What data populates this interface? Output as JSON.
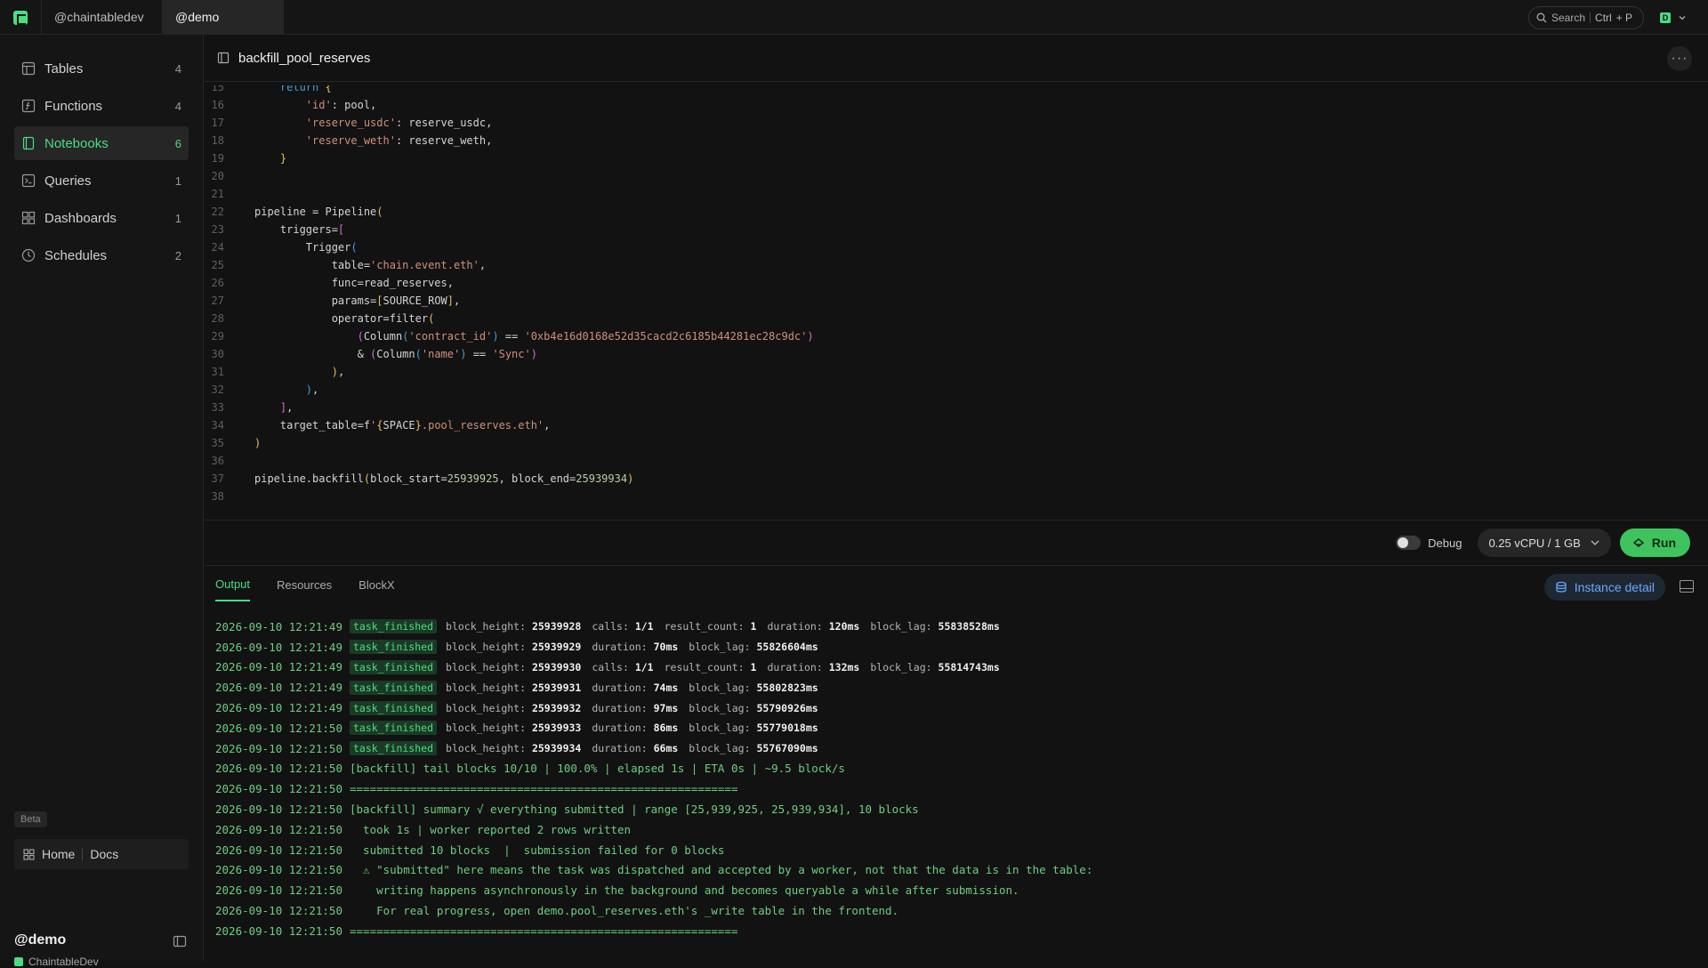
{
  "topbar": {
    "tabs": [
      {
        "label": "@chaintabledev"
      },
      {
        "label": "@demo"
      }
    ],
    "search": {
      "label": "Search",
      "shortcut_mod": "Ctrl",
      "shortcut_key": "+ P"
    },
    "account": {
      "badge": "D"
    }
  },
  "sidebar": {
    "items": [
      {
        "label": "Tables",
        "count": "4",
        "icon": "table-icon"
      },
      {
        "label": "Functions",
        "count": "4",
        "icon": "function-icon"
      },
      {
        "label": "Notebooks",
        "count": "6",
        "icon": "notebook-icon",
        "active": true
      },
      {
        "label": "Queries",
        "count": "1",
        "icon": "terminal-icon"
      },
      {
        "label": "Dashboards",
        "count": "1",
        "icon": "dashboard-icon"
      },
      {
        "label": "Schedules",
        "count": "2",
        "icon": "clock-icon"
      }
    ],
    "beta_label": "Beta",
    "home_label": "Home",
    "docs_label": "Docs",
    "space_name": "@demo",
    "space_org": "ChaintableDev"
  },
  "notebook": {
    "title": "backfill_pool_reserves",
    "code_first_line": "15",
    "code_last_line": "38"
  },
  "run_bar": {
    "debug_label": "Debug",
    "resource": "0.25 vCPU / 1 GB",
    "run_label": "Run"
  },
  "output": {
    "tabs": [
      "Output",
      "Resources",
      "BlockX"
    ],
    "active_tab": "Output",
    "instance_detail_label": "Instance detail",
    "badge_text": "task_finished",
    "rows": [
      {
        "ts": "2026-09-10 12:21:49",
        "kv": [
          [
            "block_height:",
            "25939928"
          ],
          [
            "calls:",
            "1/1"
          ],
          [
            "result_count:",
            "1"
          ],
          [
            "duration:",
            "120ms"
          ],
          [
            "block_lag:",
            "55838528ms"
          ]
        ]
      },
      {
        "ts": "2026-09-10 12:21:49",
        "kv": [
          [
            "block_height:",
            "25939929"
          ],
          [
            "duration:",
            "70ms"
          ],
          [
            "block_lag:",
            "55826604ms"
          ]
        ]
      },
      {
        "ts": "2026-09-10 12:21:49",
        "kv": [
          [
            "block_height:",
            "25939930"
          ],
          [
            "calls:",
            "1/1"
          ],
          [
            "result_count:",
            "1"
          ],
          [
            "duration:",
            "132ms"
          ],
          [
            "block_lag:",
            "55814743ms"
          ]
        ]
      },
      {
        "ts": "2026-09-10 12:21:49",
        "kv": [
          [
            "block_height:",
            "25939931"
          ],
          [
            "duration:",
            "74ms"
          ],
          [
            "block_lag:",
            "55802823ms"
          ]
        ]
      },
      {
        "ts": "2026-09-10 12:21:49",
        "kv": [
          [
            "block_height:",
            "25939932"
          ],
          [
            "duration:",
            "97ms"
          ],
          [
            "block_lag:",
            "55790926ms"
          ]
        ]
      },
      {
        "ts": "2026-09-10 12:21:50",
        "kv": [
          [
            "block_height:",
            "25939933"
          ],
          [
            "duration:",
            "86ms"
          ],
          [
            "block_lag:",
            "55779018ms"
          ]
        ]
      },
      {
        "ts": "2026-09-10 12:21:50",
        "kv": [
          [
            "block_height:",
            "25939934"
          ],
          [
            "duration:",
            "66ms"
          ],
          [
            "block_lag:",
            "55767090ms"
          ]
        ]
      },
      {
        "ts": "2026-09-10 12:21:50",
        "msg": "[backfill] tail blocks 10/10 | 100.0% | elapsed 1s | ETA 0s | ~9.5 block/s"
      },
      {
        "ts": "2026-09-10 12:21:50",
        "msg": "=========================================================="
      },
      {
        "ts": "2026-09-10 12:21:50",
        "msg": "[backfill] summary √ everything submitted | range [25,939,925, 25,939,934], 10 blocks"
      },
      {
        "ts": "2026-09-10 12:21:50",
        "msg": "  took 1s | worker reported 2 rows written"
      },
      {
        "ts": "2026-09-10 12:21:50",
        "msg": "  submitted 10 blocks  |  submission failed for 0 blocks"
      },
      {
        "ts": "2026-09-10 12:21:50",
        "msg": "  ⚠ \"submitted\" here means the task was dispatched and accepted by a worker, not that the data is in the table:"
      },
      {
        "ts": "2026-09-10 12:21:50",
        "msg": "    writing happens asynchronously in the background and becomes queryable a while after submission."
      },
      {
        "ts": "2026-09-10 12:21:50",
        "msg": "    For real progress, open demo.pool_reserves.eth's _write table in the frontend."
      },
      {
        "ts": "2026-09-10 12:21:50",
        "msg": "=========================================================="
      }
    ]
  },
  "code_lines": [
    {
      "n": "15",
      "html": "    <span class=\"b3\">return</span> <span class=\"b1\">{</span>"
    },
    {
      "n": "16",
      "html": "        <span class=\"s\">'id'</span>: pool,"
    },
    {
      "n": "17",
      "html": "        <span class=\"s\">'reserve_usdc'</span>: reserve_usdc,"
    },
    {
      "n": "18",
      "html": "        <span class=\"s\">'reserve_weth'</span>: reserve_weth,"
    },
    {
      "n": "19",
      "html": "    <span class=\"b1\">}</span>"
    },
    {
      "n": "20",
      "html": ""
    },
    {
      "n": "21",
      "html": ""
    },
    {
      "n": "22",
      "html": "pipeline = Pipeline<span class=\"b1\">(</span>"
    },
    {
      "n": "23",
      "html": "    triggers=<span class=\"b2\">[</span>"
    },
    {
      "n": "24",
      "html": "        Trigger<span class=\"b3\">(</span>"
    },
    {
      "n": "25",
      "html": "            table=<span class=\"s\">'chain.event.eth'</span>,"
    },
    {
      "n": "26",
      "html": "            func=read_reserves,"
    },
    {
      "n": "27",
      "html": "            params=<span class=\"b1\">[</span>SOURCE_ROW<span class=\"b1\">]</span>,"
    },
    {
      "n": "28",
      "html": "            operator=filter<span class=\"b1\">(</span>"
    },
    {
      "n": "29",
      "html": "                <span class=\"b2\">(</span>Column<span class=\"b3\">(</span><span class=\"s\">'contract_id'</span><span class=\"b3\">)</span> == <span class=\"s\">'0xb4e16d0168e52d35cacd2c6185b44281ec28c9dc'</span><span class=\"b2\">)</span>"
    },
    {
      "n": "30",
      "html": "                &amp; <span class=\"b2\">(</span>Column<span class=\"b3\">(</span><span class=\"s\">'name'</span><span class=\"b3\">)</span> == <span class=\"s\">'Sync'</span><span class=\"b2\">)</span>"
    },
    {
      "n": "31",
      "html": "            <span class=\"b1\">)</span>,"
    },
    {
      "n": "32",
      "html": "        <span class=\"b3\">)</span>,"
    },
    {
      "n": "33",
      "html": "    <span class=\"b2\">]</span>,"
    },
    {
      "n": "34",
      "html": "    target_table=f<span class=\"s\">'</span><span class=\"b1\">{</span>SPACE<span class=\"b1\">}</span><span class=\"s\">.pool_reserves.eth'</span>,"
    },
    {
      "n": "35",
      "html": "<span class=\"b1\">)</span>"
    },
    {
      "n": "36",
      "html": ""
    },
    {
      "n": "37",
      "html": "pipeline.backfill<span class=\"b1\">(</span>block_start=<span class=\"n\">25939925</span>, block_end=<span class=\"n\">25939934</span><span class=\"b1\">)</span>"
    },
    {
      "n": "38",
      "html": ""
    }
  ],
  "colors": {
    "accent": "#4ade80",
    "link": "#6aa9ff",
    "run": "#3ec35e"
  }
}
